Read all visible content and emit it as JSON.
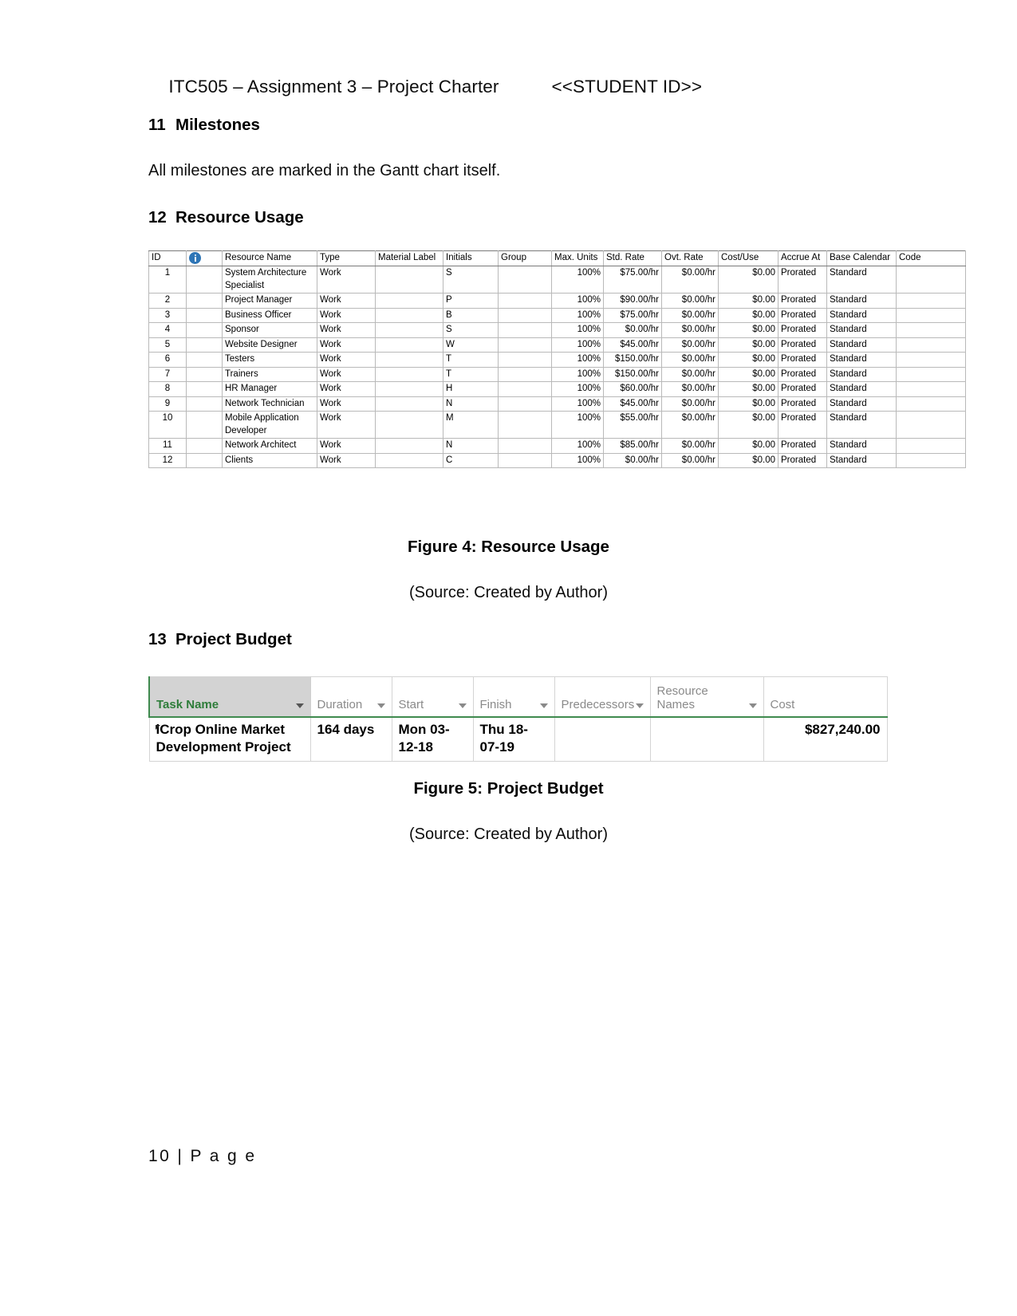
{
  "document": {
    "header": {
      "title": "ITC505 – Assignment 3 – Project Charter",
      "student_id": "<<STUDENT ID>>"
    },
    "footer": {
      "page_label": "10 | P a g e"
    }
  },
  "sections": {
    "milestones": {
      "number": "11",
      "title": "Milestones",
      "paragraph": "All milestones are marked in the Gantt chart itself."
    },
    "resource_usage": {
      "number": "12",
      "title": "Resource Usage"
    },
    "project_budget": {
      "number": "13",
      "title": "Project Budget"
    }
  },
  "figures": {
    "fig4": {
      "caption": "Figure 4: Resource Usage",
      "source": "(Source: Created by Author)"
    },
    "fig5": {
      "caption": "Figure 5: Project Budget",
      "source": "(Source: Created by Author)"
    }
  },
  "resource_table": {
    "columns": [
      "ID",
      "info-icon",
      "Resource Name",
      "Type",
      "Material Label",
      "Initials",
      "Group",
      "Max. Units",
      "Std. Rate",
      "Ovt. Rate",
      "Cost/Use",
      "Accrue At",
      "Base Calendar",
      "Code"
    ],
    "rows": [
      {
        "id": "1",
        "name": "System Architecture Specialist",
        "type": "Work",
        "material_label": "",
        "initials": "S",
        "group": "",
        "max_units": "100%",
        "std_rate": "$75.00/hr",
        "ovt_rate": "$0.00/hr",
        "cost_use": "$0.00",
        "accrue_at": "Prorated",
        "base_calendar": "Standard",
        "code": ""
      },
      {
        "id": "2",
        "name": "Project Manager",
        "type": "Work",
        "material_label": "",
        "initials": "P",
        "group": "",
        "max_units": "100%",
        "std_rate": "$90.00/hr",
        "ovt_rate": "$0.00/hr",
        "cost_use": "$0.00",
        "accrue_at": "Prorated",
        "base_calendar": "Standard",
        "code": ""
      },
      {
        "id": "3",
        "name": "Business Officer",
        "type": "Work",
        "material_label": "",
        "initials": "B",
        "group": "",
        "max_units": "100%",
        "std_rate": "$75.00/hr",
        "ovt_rate": "$0.00/hr",
        "cost_use": "$0.00",
        "accrue_at": "Prorated",
        "base_calendar": "Standard",
        "code": ""
      },
      {
        "id": "4",
        "name": "Sponsor",
        "type": "Work",
        "material_label": "",
        "initials": "S",
        "group": "",
        "max_units": "100%",
        "std_rate": "$0.00/hr",
        "ovt_rate": "$0.00/hr",
        "cost_use": "$0.00",
        "accrue_at": "Prorated",
        "base_calendar": "Standard",
        "code": ""
      },
      {
        "id": "5",
        "name": "Website Designer",
        "type": "Work",
        "material_label": "",
        "initials": "W",
        "group": "",
        "max_units": "100%",
        "std_rate": "$45.00/hr",
        "ovt_rate": "$0.00/hr",
        "cost_use": "$0.00",
        "accrue_at": "Prorated",
        "base_calendar": "Standard",
        "code": ""
      },
      {
        "id": "6",
        "name": "Testers",
        "type": "Work",
        "material_label": "",
        "initials": "T",
        "group": "",
        "max_units": "100%",
        "std_rate": "$150.00/hr",
        "ovt_rate": "$0.00/hr",
        "cost_use": "$0.00",
        "accrue_at": "Prorated",
        "base_calendar": "Standard",
        "code": ""
      },
      {
        "id": "7",
        "name": "Trainers",
        "type": "Work",
        "material_label": "",
        "initials": "T",
        "group": "",
        "max_units": "100%",
        "std_rate": "$150.00/hr",
        "ovt_rate": "$0.00/hr",
        "cost_use": "$0.00",
        "accrue_at": "Prorated",
        "base_calendar": "Standard",
        "code": ""
      },
      {
        "id": "8",
        "name": "HR Manager",
        "type": "Work",
        "material_label": "",
        "initials": "H",
        "group": "",
        "max_units": "100%",
        "std_rate": "$60.00/hr",
        "ovt_rate": "$0.00/hr",
        "cost_use": "$0.00",
        "accrue_at": "Prorated",
        "base_calendar": "Standard",
        "code": ""
      },
      {
        "id": "9",
        "name": "Network Technician",
        "type": "Work",
        "material_label": "",
        "initials": "N",
        "group": "",
        "max_units": "100%",
        "std_rate": "$45.00/hr",
        "ovt_rate": "$0.00/hr",
        "cost_use": "$0.00",
        "accrue_at": "Prorated",
        "base_calendar": "Standard",
        "code": ""
      },
      {
        "id": "10",
        "name": "Mobile Application Developer",
        "type": "Work",
        "material_label": "",
        "initials": "M",
        "group": "",
        "max_units": "100%",
        "std_rate": "$55.00/hr",
        "ovt_rate": "$0.00/hr",
        "cost_use": "$0.00",
        "accrue_at": "Prorated",
        "base_calendar": "Standard",
        "code": ""
      },
      {
        "id": "11",
        "name": "Network Architect",
        "type": "Work",
        "material_label": "",
        "initials": "N",
        "group": "",
        "max_units": "100%",
        "std_rate": "$85.00/hr",
        "ovt_rate": "$0.00/hr",
        "cost_use": "$0.00",
        "accrue_at": "Prorated",
        "base_calendar": "Standard",
        "code": ""
      },
      {
        "id": "12",
        "name": "Clients",
        "type": "Work",
        "material_label": "",
        "initials": "C",
        "group": "",
        "max_units": "100%",
        "std_rate": "$0.00/hr",
        "ovt_rate": "$0.00/hr",
        "cost_use": "$0.00",
        "accrue_at": "Prorated",
        "base_calendar": "Standard",
        "code": ""
      }
    ]
  },
  "budget_table": {
    "columns": [
      "Task Name",
      "Duration",
      "Start",
      "Finish",
      "Predecessors",
      "Resource Names",
      "Cost"
    ],
    "rows": [
      {
        "task_name": "iCrop Online Market Development Project",
        "duration": "164 days",
        "start": "Mon 03-12-18",
        "finish": "Thu 18-07-19",
        "predecessors": "",
        "resource_names": "",
        "cost": "$827,240.00"
      }
    ]
  },
  "colors": {
    "header_accent_green": "#2e7d3a",
    "header_underline_green": "#3f8a4e",
    "header_fill_gray": "#d3d3d3",
    "info_icon_blue": "#2e75b6",
    "grid_line": "#b9b9b9"
  }
}
